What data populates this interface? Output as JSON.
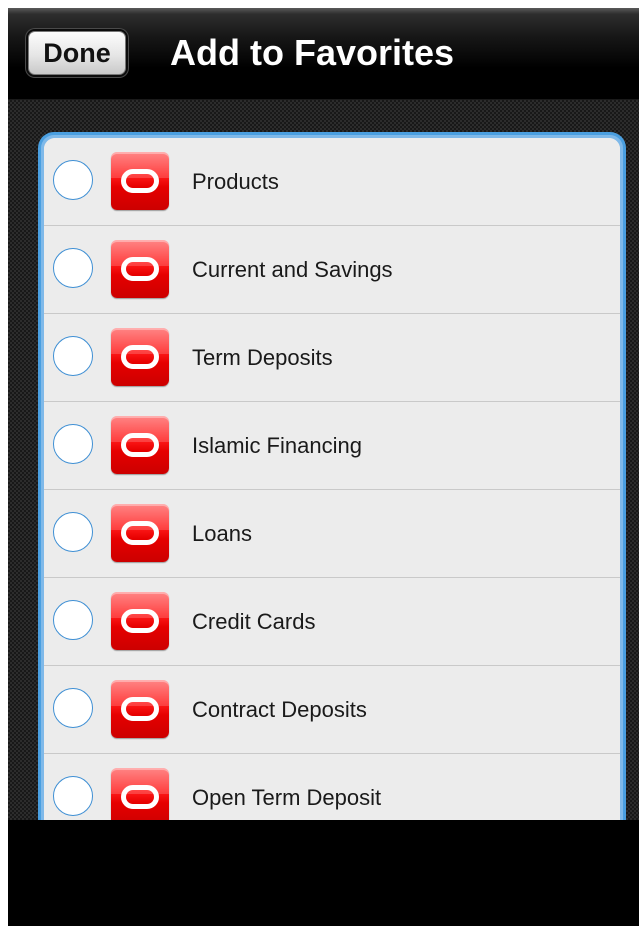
{
  "navbar": {
    "done_label": "Done",
    "title": "Add to Favorites"
  },
  "list": {
    "items": [
      {
        "label": "Products",
        "icon": "oracle-logo-icon",
        "selected": false
      },
      {
        "label": "Current and Savings",
        "icon": "oracle-logo-icon",
        "selected": false
      },
      {
        "label": "Term Deposits",
        "icon": "oracle-logo-icon",
        "selected": false
      },
      {
        "label": "Islamic Financing",
        "icon": "oracle-logo-icon",
        "selected": false
      },
      {
        "label": "Loans",
        "icon": "oracle-logo-icon",
        "selected": false
      },
      {
        "label": "Credit Cards",
        "icon": "oracle-logo-icon",
        "selected": false
      },
      {
        "label": "Contract Deposits",
        "icon": "oracle-logo-icon",
        "selected": false
      },
      {
        "label": "Open Term Deposit",
        "icon": "oracle-logo-icon",
        "selected": false
      }
    ]
  },
  "colors": {
    "accent": "#4a9fe0",
    "icon_red": "#e60000",
    "list_background": "#ececec"
  }
}
